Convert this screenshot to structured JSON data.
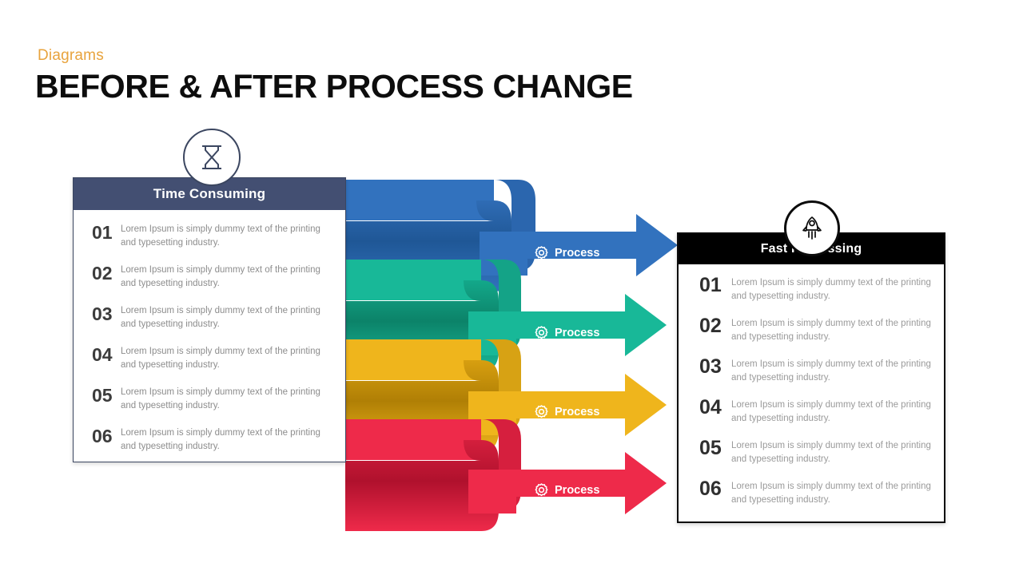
{
  "header": {
    "kicker": "Diagrams",
    "title": "BEFORE & AFTER PROCESS CHANGE"
  },
  "left_panel": {
    "icon": "hourglass-icon",
    "header_title": "Time Consuming",
    "header_bg": "#434f72",
    "border_color": "#3b4660",
    "items": [
      {
        "num": "01",
        "text": "Lorem Ipsum is simply dummy text of the printing and typesetting industry."
      },
      {
        "num": "02",
        "text": "Lorem Ipsum is simply dummy text of the printing and typesetting industry."
      },
      {
        "num": "03",
        "text": "Lorem Ipsum is simply dummy text of the printing and typesetting industry."
      },
      {
        "num": "04",
        "text": "Lorem Ipsum is simply dummy text of the printing and typesetting industry."
      },
      {
        "num": "05",
        "text": "Lorem Ipsum is simply dummy text of the printing and typesetting industry."
      },
      {
        "num": "06",
        "text": "Lorem Ipsum is simply dummy text of the printing and typesetting industry."
      }
    ]
  },
  "right_panel": {
    "icon": "rocket-icon",
    "header_title": "Fast Processing",
    "header_bg": "#000000",
    "border_color": "#0b0b0b",
    "items": [
      {
        "num": "01",
        "text": "Lorem Ipsum is simply dummy text of the printing and typesetting industry."
      },
      {
        "num": "02",
        "text": "Lorem Ipsum is simply dummy text of the printing and typesetting industry."
      },
      {
        "num": "03",
        "text": "Lorem Ipsum is simply dummy text of the printing and typesetting industry."
      },
      {
        "num": "04",
        "text": "Lorem Ipsum is simply dummy text of the printing and typesetting industry."
      },
      {
        "num": "05",
        "text": "Lorem Ipsum is simply dummy text of the printing and typesetting industry."
      },
      {
        "num": "06",
        "text": "Lorem Ipsum is simply dummy text of the printing and typesetting industry."
      }
    ]
  },
  "ribbons": [
    {
      "label": "Process",
      "icon": "gear-icon",
      "color": "#3272be",
      "shade": "#245d9f",
      "dark": "#1f5796"
    },
    {
      "label": "Process",
      "icon": "gear-icon",
      "color": "#18b898",
      "shade": "#0e8f76",
      "dark": "#0c8369"
    },
    {
      "label": "Process",
      "icon": "gear-icon",
      "color": "#efb51c",
      "shade": "#c08c07",
      "dark": "#b07f05"
    },
    {
      "label": "Process",
      "icon": "gear-icon",
      "color": "#ee2a4a",
      "shade": "#c11534",
      "dark": "#b0112d"
    }
  ],
  "colors": {
    "accent_kicker": "#e8a33d",
    "title": "#0d0d0d",
    "body_text": "#8d8d8d",
    "number_text": "#3c3c3c",
    "background": "#ffffff"
  }
}
